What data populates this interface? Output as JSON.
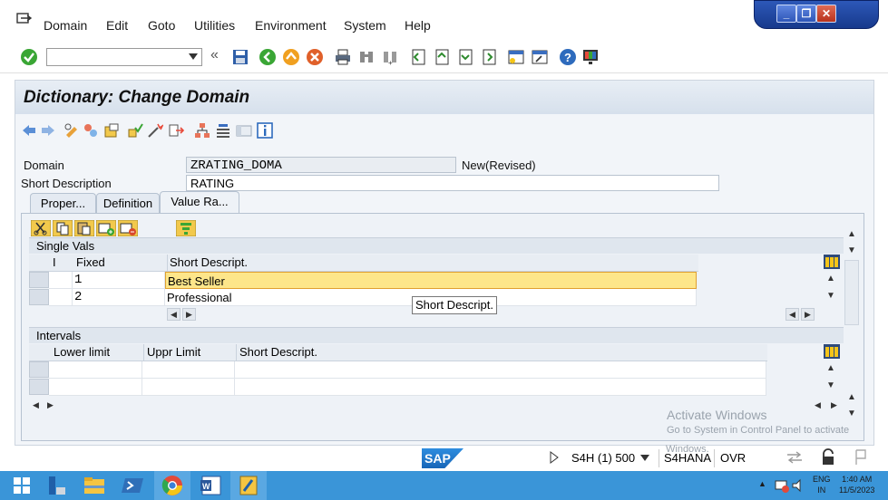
{
  "menu": {
    "items": [
      "Domain",
      "Edit",
      "Goto",
      "Utilities",
      "Environment",
      "System",
      "Help"
    ]
  },
  "window_controls": {
    "minimize": "_",
    "restore": "❐",
    "close": "✕"
  },
  "toolbar": {
    "command_value": "",
    "nav_back_symbol": "«"
  },
  "screen": {
    "title": "Dictionary: Change Domain"
  },
  "header_fields": {
    "domain_label": "Domain",
    "domain_value": "ZRATING_DOMA",
    "domain_status": "New(Revised)",
    "short_desc_label": "Short Description",
    "short_desc_value": "RATING"
  },
  "tabs": [
    {
      "label": "Proper...",
      "active": false
    },
    {
      "label": "Definition",
      "active": false
    },
    {
      "label": "Value Ra...",
      "active": true
    }
  ],
  "single_vals": {
    "section_label": "Single Vals",
    "columns": [
      "I",
      "Fixed",
      "Short Descript."
    ],
    "rows": [
      {
        "fixed": "1",
        "desc": "Best Seller"
      },
      {
        "fixed": "2",
        "desc": "Professional"
      }
    ],
    "tooltip": "Short Descript."
  },
  "intervals": {
    "section_label": "Intervals",
    "columns": [
      "Lower limit",
      "Uppr Limit",
      "Short Descript."
    ]
  },
  "activation": {
    "line1": "Activate Windows",
    "line2": "Go to System in Control Panel to activate",
    "line3": "Windows."
  },
  "statusbar": {
    "system": "S4H (1) 500",
    "server": "S4HANA",
    "mode": "OVR",
    "logo": "SAP"
  },
  "taskbar": {
    "lang_top": "ENG",
    "lang_bottom": "IN",
    "time": "1:40 AM",
    "date": "11/5/2023"
  },
  "colors": {
    "accent": "#3a95d8",
    "highlight_row": "#fde68a",
    "title_bg": "#dbe4ee"
  }
}
